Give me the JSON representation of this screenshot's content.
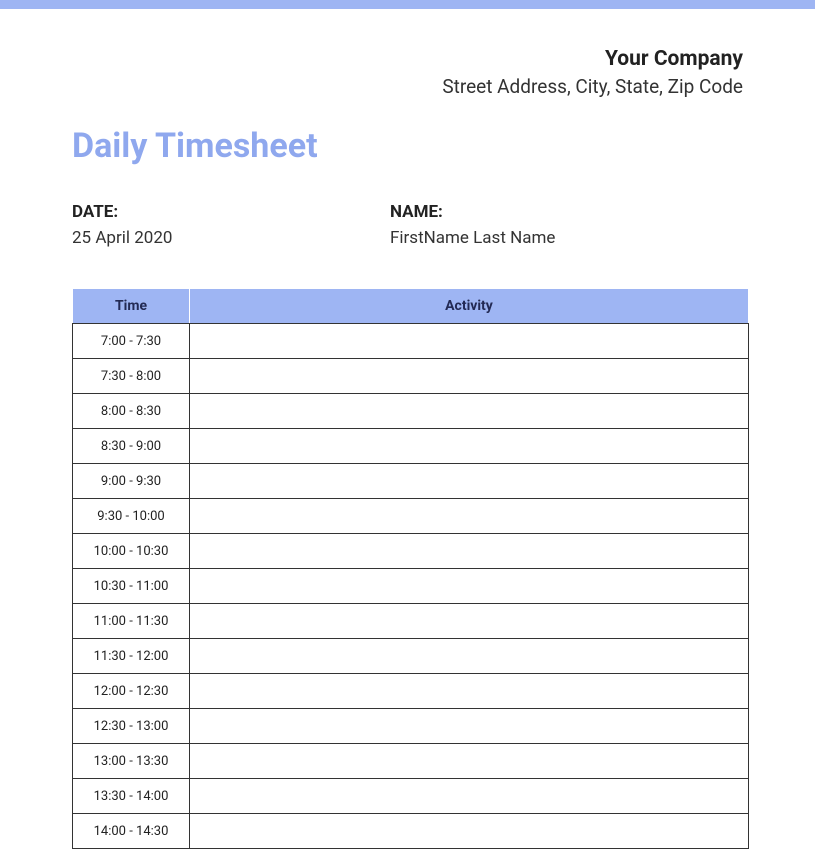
{
  "header": {
    "company_name": "Your Company",
    "company_address": "Street Address, City, State, Zip Code"
  },
  "title": "Daily Timesheet",
  "meta": {
    "date_label": "DATE:",
    "date_value": "25 April 2020",
    "name_label": "NAME:",
    "name_value": "FirstName Last Name"
  },
  "table": {
    "headers": {
      "time": "Time",
      "activity": "Activity"
    },
    "rows": [
      {
        "time": "7:00 - 7:30",
        "activity": ""
      },
      {
        "time": "7:30 - 8:00",
        "activity": ""
      },
      {
        "time": "8:00 - 8:30",
        "activity": ""
      },
      {
        "time": "8:30 - 9:00",
        "activity": ""
      },
      {
        "time": "9:00 - 9:30",
        "activity": ""
      },
      {
        "time": "9:30 - 10:00",
        "activity": ""
      },
      {
        "time": "10:00 - 10:30",
        "activity": ""
      },
      {
        "time": "10:30 - 11:00",
        "activity": ""
      },
      {
        "time": "11:00 - 11:30",
        "activity": ""
      },
      {
        "time": "11:30 - 12:00",
        "activity": ""
      },
      {
        "time": "12:00 - 12:30",
        "activity": ""
      },
      {
        "time": "12:30 - 13:00",
        "activity": ""
      },
      {
        "time": "13:00 - 13:30",
        "activity": ""
      },
      {
        "time": "13:30 - 14:00",
        "activity": ""
      },
      {
        "time": "14:00 - 14:30",
        "activity": ""
      }
    ]
  }
}
